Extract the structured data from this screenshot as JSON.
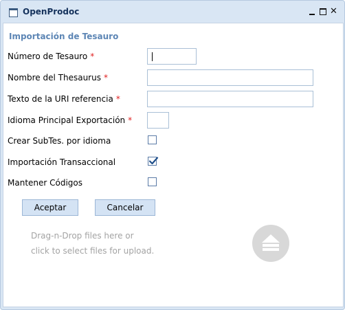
{
  "window": {
    "title": "OpenProdoc",
    "controls": [
      "minimize",
      "maximize",
      "close"
    ]
  },
  "form": {
    "section_title": "Importación de Tesauro",
    "required_marker": "*",
    "fields": {
      "thesaurus_number": {
        "label": "Número de Tesauro",
        "value": "",
        "required": true
      },
      "thesaurus_name": {
        "label": "Nombre del Thesaurus",
        "value": "",
        "required": true
      },
      "uri_text": {
        "label": "Texto de la URI referencia",
        "value": "",
        "required": true
      },
      "main_language": {
        "label": "Idioma Principal Exportación",
        "value": "",
        "required": true
      },
      "create_subtes": {
        "label": "Crear SubTes. por idioma",
        "checked": false
      },
      "transactional_import": {
        "label": "Importación Transaccional",
        "checked": true
      },
      "keep_codes": {
        "label": "Mantener Códigos",
        "checked": false
      }
    },
    "buttons": {
      "accept": "Aceptar",
      "cancel": "Cancelar"
    }
  },
  "upload": {
    "line1": "Drag-n-Drop files here or",
    "line2": "click to select files for upload.",
    "icon": "upload-icon"
  },
  "colors": {
    "window_bg": "#d9e6f4",
    "title_text": "#15325c",
    "section_title": "#5d86b5",
    "required": "#e02020",
    "button_bg": "#d4e3f4",
    "checkmark": "#1f4f8a"
  }
}
